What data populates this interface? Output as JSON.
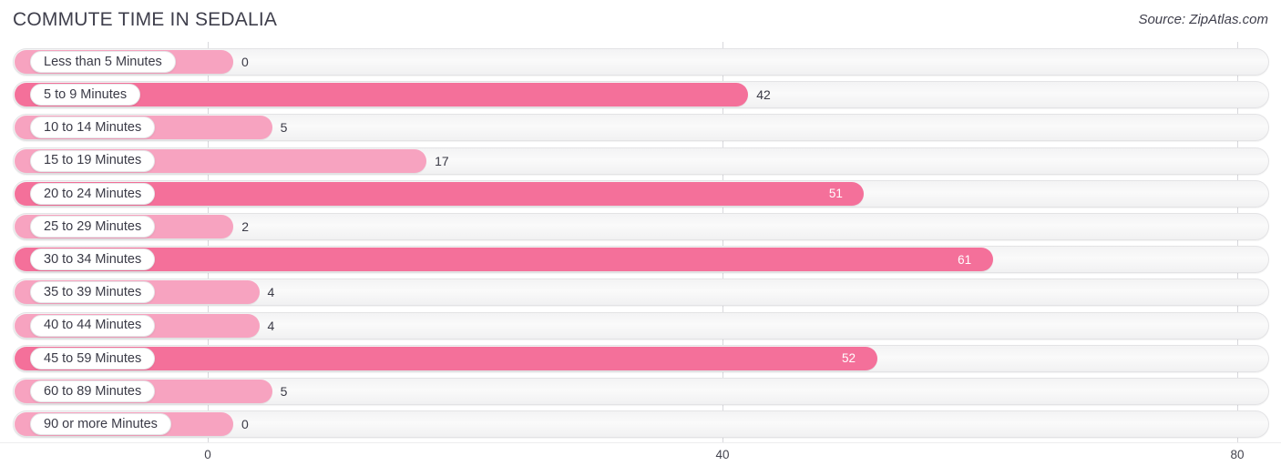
{
  "header": {
    "title": "COMMUTE TIME IN SEDALIA",
    "source": "Source: ZipAtlas.com"
  },
  "axis": {
    "ticks": [
      "0",
      "40",
      "80"
    ],
    "tick_values": [
      0,
      40,
      80
    ]
  },
  "colors": {
    "bar_dark": "#f4709a",
    "bar_light": "#f7a3c0",
    "track": "#f6f6f7",
    "text": "#3a3a46",
    "value_inside": "#ffffff"
  },
  "chart_data": {
    "type": "bar",
    "orientation": "horizontal",
    "title": "COMMUTE TIME IN SEDALIA",
    "xlabel": "",
    "ylabel": "",
    "xlim": [
      0,
      80
    ],
    "grid": true,
    "legend": false,
    "categories": [
      "Less than 5 Minutes",
      "5 to 9 Minutes",
      "10 to 14 Minutes",
      "15 to 19 Minutes",
      "20 to 24 Minutes",
      "25 to 29 Minutes",
      "30 to 34 Minutes",
      "35 to 39 Minutes",
      "40 to 44 Minutes",
      "45 to 59 Minutes",
      "60 to 89 Minutes",
      "90 or more Minutes"
    ],
    "values": [
      0,
      42,
      5,
      17,
      51,
      2,
      61,
      4,
      4,
      52,
      5,
      0
    ],
    "value_labels": [
      "0",
      "42",
      "5",
      "17",
      "51",
      "2",
      "61",
      "4",
      "4",
      "52",
      "5",
      "0"
    ],
    "bars": [
      {
        "label": "Less than 5 Minutes",
        "value": 0,
        "display": "0",
        "shade": "light",
        "label_inside": false
      },
      {
        "label": "5 to 9 Minutes",
        "value": 42,
        "display": "42",
        "shade": "dark",
        "label_inside": false
      },
      {
        "label": "10 to 14 Minutes",
        "value": 5,
        "display": "5",
        "shade": "light",
        "label_inside": false
      },
      {
        "label": "15 to 19 Minutes",
        "value": 17,
        "display": "17",
        "shade": "light",
        "label_inside": false
      },
      {
        "label": "20 to 24 Minutes",
        "value": 51,
        "display": "51",
        "shade": "dark",
        "label_inside": true
      },
      {
        "label": "25 to 29 Minutes",
        "value": 2,
        "display": "2",
        "shade": "light",
        "label_inside": false
      },
      {
        "label": "30 to 34 Minutes",
        "value": 61,
        "display": "61",
        "shade": "dark",
        "label_inside": true
      },
      {
        "label": "35 to 39 Minutes",
        "value": 4,
        "display": "4",
        "shade": "light",
        "label_inside": false
      },
      {
        "label": "40 to 44 Minutes",
        "value": 4,
        "display": "4",
        "shade": "light",
        "label_inside": false
      },
      {
        "label": "45 to 59 Minutes",
        "value": 52,
        "display": "52",
        "shade": "dark",
        "label_inside": true
      },
      {
        "label": "60 to 89 Minutes",
        "value": 5,
        "display": "5",
        "shade": "light",
        "label_inside": false
      },
      {
        "label": "90 or more Minutes",
        "value": 0,
        "display": "0",
        "shade": "light",
        "label_inside": false
      }
    ]
  }
}
